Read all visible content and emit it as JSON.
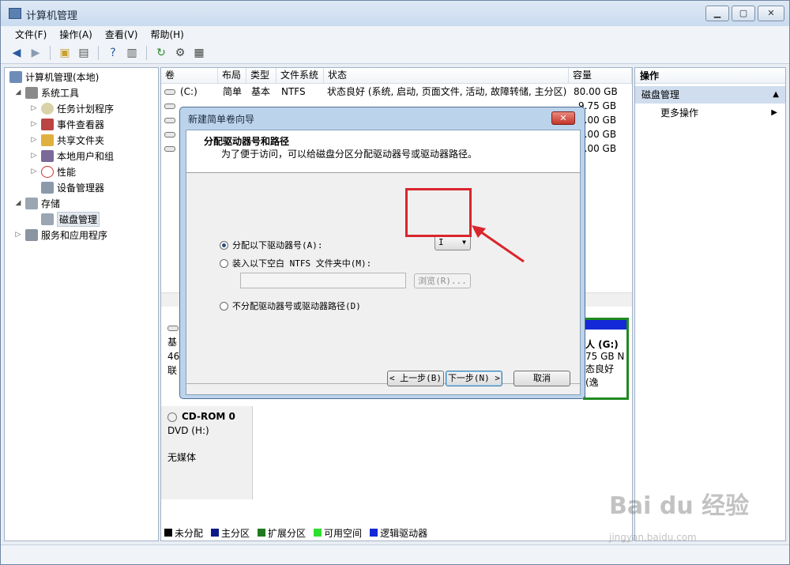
{
  "window": {
    "title": "计算机管理"
  },
  "caption_buttons": {
    "minimize": "▁",
    "maximize": "▢",
    "close": "✕"
  },
  "menu": [
    "文件(F)",
    "操作(A)",
    "查看(V)",
    "帮助(H)"
  ],
  "toolbar_icons": [
    "back-icon",
    "forward-icon",
    "up-folder-icon",
    "show-hide-tree-icon",
    "help-icon",
    "properties-icon",
    "refresh-icon",
    "settings-icon",
    "export-icon"
  ],
  "tree": {
    "root": "计算机管理(本地)",
    "system_tools": "系统工具",
    "task_scheduler": "任务计划程序",
    "event_viewer": "事件查看器",
    "shared_folders": "共享文件夹",
    "local_users": "本地用户和组",
    "performance": "性能",
    "device_manager": "设备管理器",
    "storage": "存储",
    "disk_management": "磁盘管理",
    "services_apps": "服务和应用程序"
  },
  "volumes": {
    "headers": [
      "卷",
      "布局",
      "类型",
      "文件系统",
      "状态",
      "容量"
    ],
    "rows": [
      {
        "vol": "(C:)",
        "layout": "简单",
        "type": "基本",
        "fs": "NTFS",
        "status": "状态良好 (系统, 启动, 页面文件, 活动, 故障转储, 主分区)",
        "cap": "80.00 GB"
      },
      {
        "cap": "9.75 GB"
      },
      {
        "cap": "0.00 GB"
      },
      {
        "cap": "8.00 GB"
      },
      {
        "cap": "8.00 GB"
      }
    ]
  },
  "disk_lower": {
    "left_labels": [
      "基",
      "46",
      "联"
    ],
    "g_volume": "人 (G:)",
    "g_size": "75 GB N",
    "g_status": "态良好 (逸",
    "cdrom": {
      "title": "CD-ROM 0",
      "drive": "DVD (H:)",
      "media": "无媒体"
    }
  },
  "legend": [
    {
      "label": "未分配",
      "color": "#000000"
    },
    {
      "label": "主分区",
      "color": "#0d1a8a"
    },
    {
      "label": "扩展分区",
      "color": "#1f7a1f"
    },
    {
      "label": "可用空间",
      "color": "#2ee02e"
    },
    {
      "label": "逻辑驱动器",
      "color": "#1328d8"
    }
  ],
  "actions": {
    "header": "操作",
    "section": "磁盘管理",
    "more": "更多操作"
  },
  "dialog": {
    "title": "新建简单卷向导",
    "heading": "分配驱动器号和路径",
    "subheading": "为了便于访问，可以给磁盘分区分配驱动器号或驱动器路径。",
    "opt_assign": "分配以下驱动器号(A):",
    "drive_letter": "I",
    "opt_mount": "装入以下空白 NTFS 文件夹中(M):",
    "browse": "浏览(R)...",
    "opt_none": "不分配驱动器号或驱动器路径(D)",
    "back": "< 上一步(B)",
    "next": "下一步(N) >",
    "cancel": "取消"
  },
  "watermark": {
    "brand": "Bai du 经验",
    "url": "jingyan.baidu.com"
  },
  "colors": {
    "highlight": "#d9262c",
    "accent": "#2a5aa0"
  }
}
